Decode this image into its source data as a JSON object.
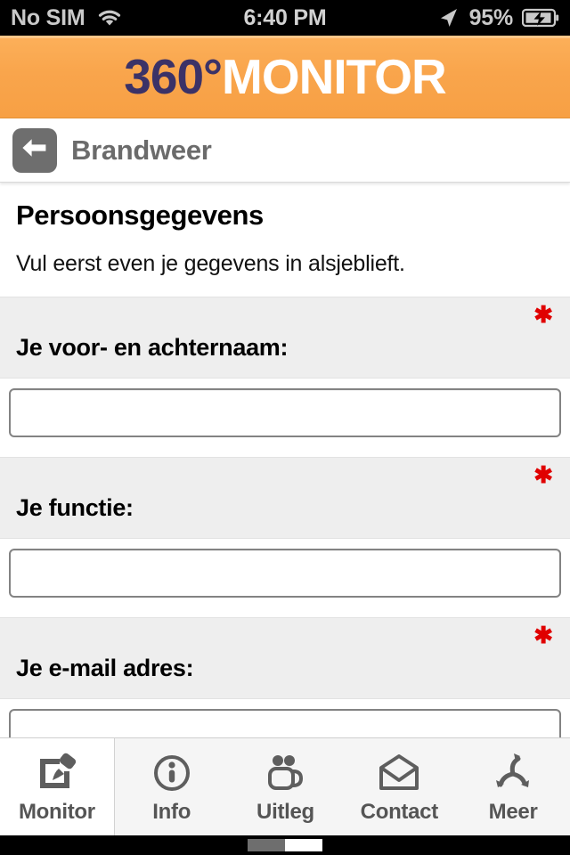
{
  "statusbar": {
    "carrier": "No SIM",
    "wifi_icon": "wifi-icon",
    "time": "6:40 PM",
    "location_icon": "location-arrow-icon",
    "battery_percent": "95%",
    "battery_icon": "battery-charging-icon"
  },
  "brand": {
    "part_a": "360°",
    "part_b": "MONITOR",
    "bg_color": "#f9a54c",
    "part_a_color": "#3b3267",
    "part_b_color": "#ffffff"
  },
  "navbar": {
    "back_icon": "arrow-left-icon",
    "title": "Brandweer"
  },
  "intro": {
    "title": "Persoonsgegevens",
    "subtitle": "Vul eerst even je gegevens in alsjeblieft."
  },
  "form": {
    "required_marker": "★",
    "required_color": "#e00000",
    "fields": [
      {
        "label": "Je voor- en achternaam:",
        "value": "",
        "placeholder": "",
        "required": true
      },
      {
        "label": "Je functie:",
        "value": "",
        "placeholder": "",
        "required": true
      },
      {
        "label": "Je e-mail adres:",
        "value": "",
        "placeholder": "",
        "required": true
      }
    ]
  },
  "tabbar": {
    "items": [
      {
        "label": "Monitor",
        "icon": "edit-square-icon",
        "active": true
      },
      {
        "label": "Info",
        "icon": "info-circle-icon",
        "active": false
      },
      {
        "label": "Uitleg",
        "icon": "people-group-icon",
        "active": false
      },
      {
        "label": "Contact",
        "icon": "envelope-icon",
        "active": false
      },
      {
        "label": "Meer",
        "icon": "branching-arrows-icon",
        "active": false
      }
    ]
  }
}
